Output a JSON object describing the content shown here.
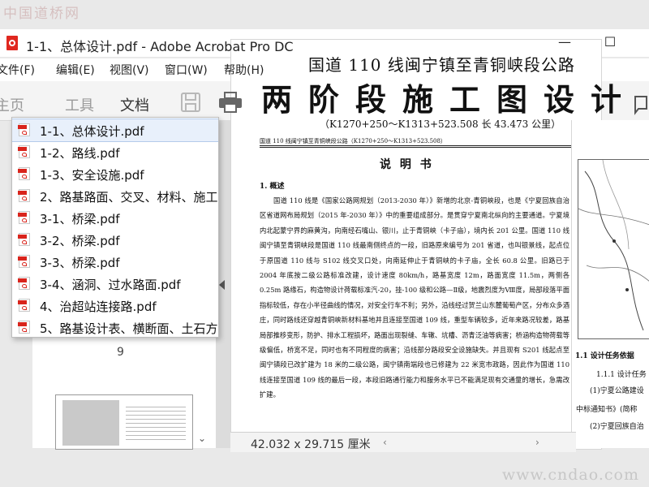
{
  "watermarks": {
    "top": "中国道桥网",
    "bottom": "www.cndao.com"
  },
  "window": {
    "title": "1-1、总体设计.pdf - Adobe Acrobat Pro DC",
    "minimize_glyph": "—",
    "maximize_glyph": "☐"
  },
  "menu": [
    "文件(F)",
    "编辑(E)",
    "视图(V)",
    "窗口(W)",
    "帮助(H)"
  ],
  "tabs": [
    "主页",
    "工具",
    "文档"
  ],
  "file_list": [
    "1-1、总体设计.pdf",
    "1-2、路线.pdf",
    "1-3、安全设施.pdf",
    "2、路基路面、交叉、材料、施工",
    "3-1、桥梁.pdf",
    "3-2、桥梁.pdf",
    "3-3、桥梁.pdf",
    "3-4、涵洞、过水路面.pdf",
    "4、治超站连接路.pdf",
    "5、路基设计表、横断面、土石方"
  ],
  "nav": {
    "page_number": "9"
  },
  "document": {
    "title_line1": "国道 110 线闽宁镇至青铜峡段公路",
    "title_line2": "两阶段施工图设计",
    "range": "（K1270+250～K1313+523.508  长 43.473 公里）",
    "header": "国道 110 线闽宁镇至青铜峡段公路（K1270+250～K1313+523.508）",
    "section_title": "说 明 书",
    "heading1": "1. 概述",
    "paragraphs": [
      "国道 110 线是《国家公路网规划（2013-2030 年）》新增的北京-青铜峡段，也是《宁夏回族自治区省道网布局规划（2015 年-2030 年）》中的重要组成部分。是贯穿宁夏南北纵向的主要通道。宁夏境内北起蒙宁界的麻黄沟，向南经石嘴山、银川，止于青铜峡（卡子庙），境内长 201 公里。国道 110 线闽宁镇至青铜峡段是国道 110 线最南侧终点的一段，旧路原来编号为 201 省道，也叫银景线，起点位于原国道 110 线与 S102 线交叉口处，向南延伸止于青铜峡的卡子庙，全长 60.8 公里。旧路已于 2004 年底按二级公路标准改建，设计速度 80km/h，路基宽度 12m，路面宽度 11.5m，两侧各 0.25m 路缘石，构造物设计荷载标准汽-20，挂-100 级和公路—Ⅱ级，地震烈度为Ⅷ度，局部段落平面指标较低，存在小半径曲线的情况，对安全行车不利；另外，沿线经过贺兰山东麓葡萄产区，分布众多酒庄，同时路线还穿越青铜峡新材料基地并且连接至国道 109 线，重型车辆较多，近年来路况较差，路基局部推移变形，防护、排水工程损坏，路面出现裂缝、车辙、坑槽、沥青泛油等病害；桥涵构造物荷载等级偏低，桥宽不足，同时也有不同程度的病害；沿线部分路段安全设施缺失。并且现有 S201 线起点至闽宁镇段已改扩建为 18 米的二级公路，闽宁镇南端段也已修建为 22 米宽市政路，因此作为国道 110 线连接至国道 109 线的最后一段，本段旧路通行能力和服务水平已不能满足现有交通量的增长，急需改扩建。"
    ],
    "side_texts": [
      "1.1 设计任务依据",
      "1.1.1 设计任务",
      "(1)宁夏公路建设",
      "中标通知书》(简称",
      "(2)宁夏回族自治"
    ]
  },
  "status": {
    "page_size": "42.032 x 29.715 厘米"
  }
}
